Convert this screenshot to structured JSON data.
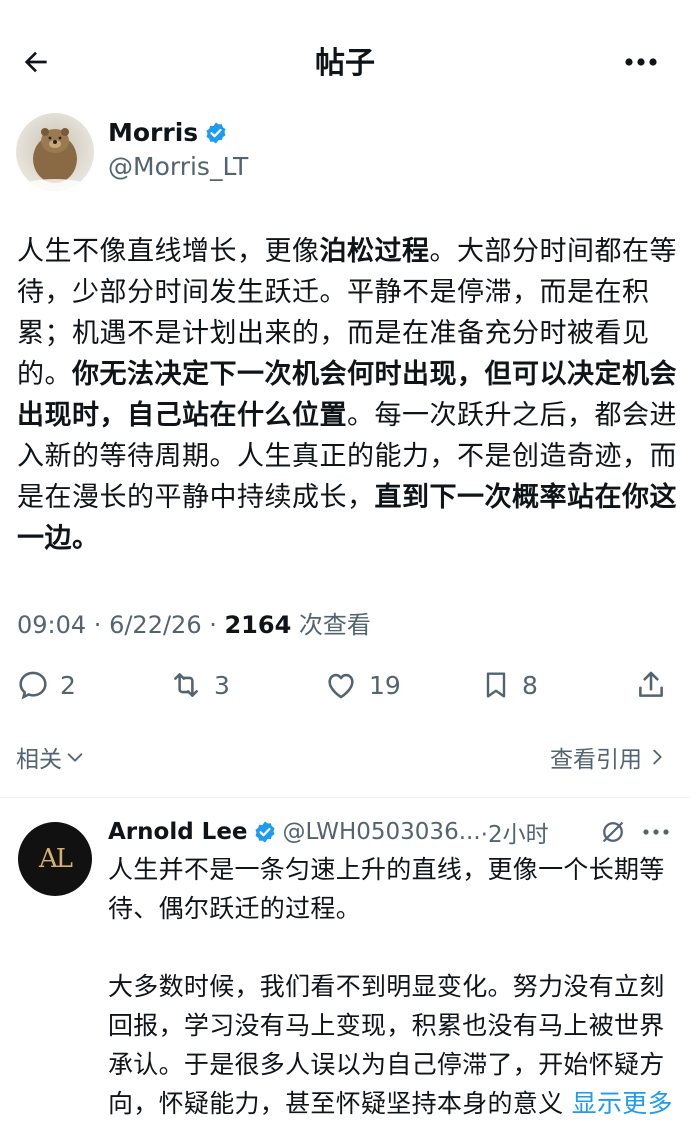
{
  "topbar": {
    "title": "帖子"
  },
  "post": {
    "author_name": "Morris",
    "author_handle": "@Morris_LT",
    "body_segments": [
      {
        "text": "人生不像直线增长，更像",
        "bold": false
      },
      {
        "text": "泊松过程",
        "bold": true
      },
      {
        "text": "。大部分时间都在等待，少部分时间发生跃迁。平静不是停滞，而是在积累；机遇不是计划出来的，而是在准备充分时被看见的。",
        "bold": false
      },
      {
        "text": "你无法决定下一次机会何时出现，但可以决定机会出现时，自己站在什么位置",
        "bold": true
      },
      {
        "text": "。每一次跃升之后，都会进入新的等待周期。人生真正的能力，不是创造奇迹，而是在漫长的平静中持续成长，",
        "bold": false
      },
      {
        "text": "直到下一次概率站在你这一边。",
        "bold": true
      }
    ],
    "time": "09:04",
    "date": "6/22/26",
    "views_count": "2164",
    "views_label": "次查看"
  },
  "actions": {
    "replies": "2",
    "reposts": "3",
    "likes": "19",
    "bookmarks": "8"
  },
  "related": {
    "label": "相关"
  },
  "quotes": {
    "label": "查看引用"
  },
  "reply": {
    "author_name": "Arnold Lee",
    "author_handle": "@LWH0503036...",
    "time": "·2小时",
    "avatar_text": "AL",
    "paragraphs": [
      "人生并不是一条匀速上升的直线，更像一个长期等待、偶尔跃迁的过程。",
      "大多数时候，我们看不到明显变化。努力没有立刻回报，学习没有马上变现，积累也没有马上被世界承认。于是很多人误以为自己停滞了，开始怀疑方向，怀疑能力，甚至怀疑坚持本身的意义"
    ],
    "show_more": "显示更多"
  },
  "colors": {
    "text": "#0f1419",
    "secondary": "#536471",
    "accent": "#1d9bf0",
    "verified": "#1d9bf0"
  }
}
